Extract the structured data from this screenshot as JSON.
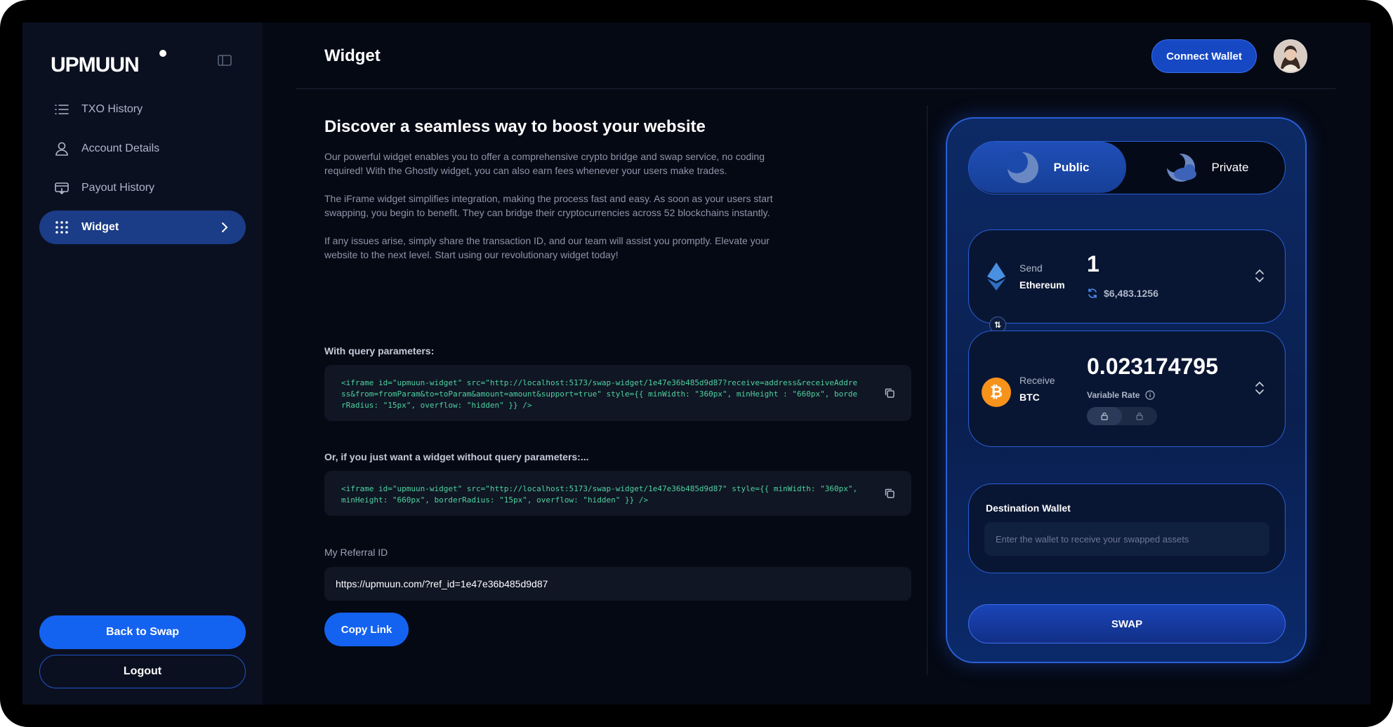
{
  "brand": {
    "logo_text": "UPMUUN"
  },
  "sidebar": {
    "items": [
      {
        "label": "TXO History",
        "icon": "list-icon"
      },
      {
        "label": "Account Details",
        "icon": "user-icon"
      },
      {
        "label": "Payout History",
        "icon": "payout-icon"
      },
      {
        "label": "Widget",
        "icon": "grid-icon",
        "active": true
      }
    ],
    "back_label": "Back to Swap",
    "logout_label": "Logout"
  },
  "header": {
    "title": "Widget",
    "connect_label": "Connect Wallet"
  },
  "main": {
    "heading": "Discover a seamless way to boost your website",
    "paragraphs": [
      "Our powerful widget enables you to offer a comprehensive crypto bridge and swap service, no coding required! With the Ghostly widget, you can also earn fees whenever your users make trades.",
      "The iFrame widget simplifies integration, making the process fast and easy. As soon as your users start swapping, you begin to benefit. They can bridge their cryptocurrencies across 52 blockchains instantly.",
      "If any issues arise, simply share the transaction ID, and our team will assist you promptly. Elevate your website to the next level. Start using our revolutionary widget today!"
    ],
    "query_label": "With query parameters:",
    "query_code": "<iframe id=\"upmuun-widget\" src=\"http://localhost:5173/swap-widget/1e47e36b485d9d87?receive=address&receiveAddress&from=fromParam&to=toParam&amount=amount&support=true\" style={{ minWidth: \"360px\", minHeight : \"660px\", borderRadius: \"15px\", overflow: \"hidden\" }} />",
    "noquery_label": "Or, if you just want a widget without query parameters:...",
    "noquery_code": "<iframe id=\"upmuun-widget\" src=\"http://localhost:5173/swap-widget/1e47e36b485d9d87\" style={{ minWidth: \"360px\", minHeight: \"660px\", borderRadius: \"15px\", overflow: \"hidden\" }} />",
    "referral_label": "My Referral ID",
    "referral_value": "https://upmuun.com/?ref_id=1e47e36b485d9d87",
    "copy_link_label": "Copy Link"
  },
  "widget": {
    "mode_public": "Public",
    "mode_private": "Private",
    "send": {
      "label": "Send",
      "coin": "Ethereum",
      "amount": "1",
      "usd": "$6,483.1256"
    },
    "receive": {
      "label": "Receive",
      "coin": "BTC",
      "amount": "0.023174795",
      "rate_label": "Variable Rate"
    },
    "destination": {
      "label": "Destination Wallet",
      "placeholder": "Enter the wallet to receive your swapped assets"
    },
    "swap_label": "SWAP"
  },
  "colors": {
    "accent": "#1462f0",
    "panel_border": "#2a5fd6",
    "code_text": "#4fd1a0",
    "btc": "#f7931a",
    "eth": "#4a90e2"
  }
}
